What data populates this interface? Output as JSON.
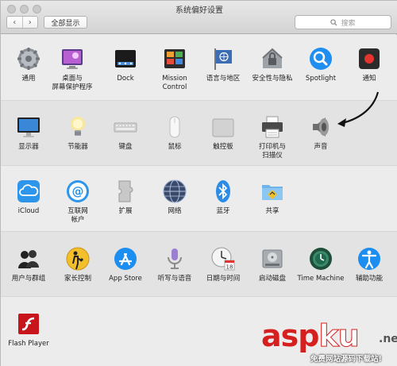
{
  "window": {
    "title": "系统偏好设置"
  },
  "toolbar": {
    "back": "‹",
    "forward": "›",
    "show_all": "全部显示",
    "search_placeholder": "搜索"
  },
  "panes": {
    "general": "通用",
    "desktop": "桌面与\n屏幕保护程序",
    "dock": "Dock",
    "mission_control": "Mission\nControl",
    "language": "语言与地区",
    "security": "安全性与隐私",
    "spotlight": "Spotlight",
    "notifications": "通知",
    "displays": "显示器",
    "energy": "节能器",
    "keyboard": "键盘",
    "mouse": "鼠标",
    "trackpad": "触控板",
    "printers": "打印机与\n扫描仪",
    "sound": "声音",
    "icloud": "iCloud",
    "internet_accounts": "互联网\n帐户",
    "extensions": "扩展",
    "network": "网络",
    "bluetooth": "蓝牙",
    "sharing": "共享",
    "users": "用户与群组",
    "parental": "家长控制",
    "appstore": "App Store",
    "dictation": "听写与语音",
    "datetime": "日期与时间",
    "startup": "启动磁盘",
    "timemachine": "Time Machine",
    "accessibility": "辅助功能",
    "flash": "Flash Player"
  },
  "watermark": {
    "brand_a": "asp",
    "brand_b": "ku",
    "brand_c": ".net",
    "tagline": "免费网站源码下载站!"
  },
  "colors": {
    "accent_blue": "#1f8ef1",
    "watermark_red": "#d62020"
  }
}
